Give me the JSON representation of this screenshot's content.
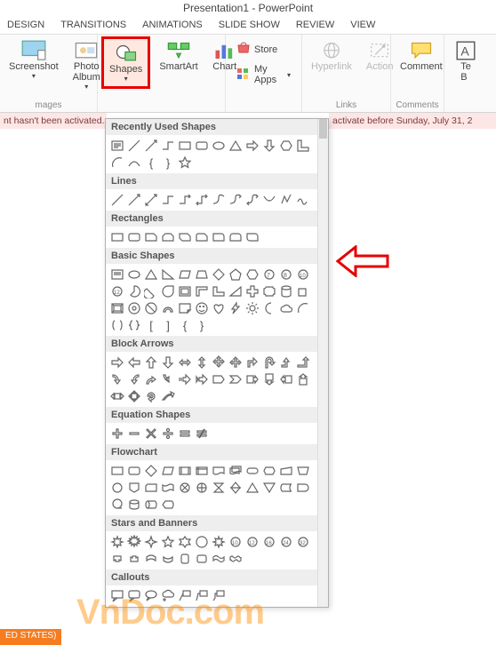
{
  "title": "Presentation1 - PowerPoint",
  "tabs": [
    "DESIGN",
    "TRANSITIONS",
    "ANIMATIONS",
    "SLIDE SHOW",
    "REVIEW",
    "VIEW"
  ],
  "ribbon": {
    "screenshot": "Screenshot",
    "photo_album": "Photo\nAlbum",
    "shapes": "Shapes",
    "smartart": "SmartArt",
    "chart": "Chart",
    "store": "Store",
    "myapps": "My Apps",
    "hyperlink": "Hyperlink",
    "action": "Action",
    "comment": "Comment",
    "textbox_partial": "Te\nB",
    "group_images": "mages",
    "group_links": "Links",
    "group_comments": "Comments"
  },
  "notice_left": "nt hasn't been activated.",
  "notice_right": "activate before Sunday, July 31, 2",
  "categories": {
    "recent": "Recently Used Shapes",
    "lines": "Lines",
    "rects": "Rectangles",
    "basic": "Basic Shapes",
    "arrows": "Block Arrows",
    "equation": "Equation Shapes",
    "flowchart": "Flowchart",
    "stars": "Stars and Banners",
    "callouts": "Callouts"
  },
  "status": "ED STATES)",
  "watermark": "VnDoc.com"
}
